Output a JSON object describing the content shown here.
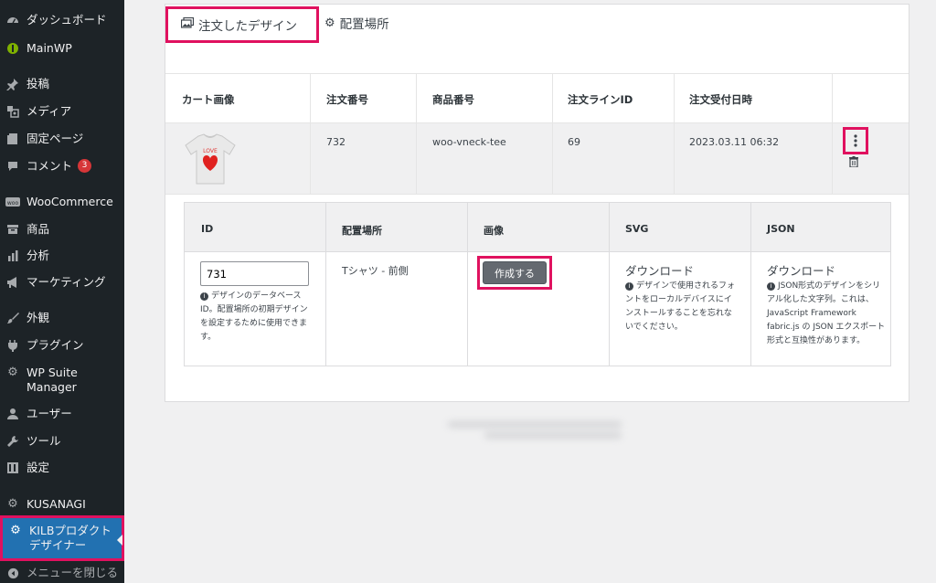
{
  "sidebar": {
    "items": [
      {
        "label": "ダッシュボード",
        "icon": "dashboard-icon"
      },
      {
        "label": "MainWP",
        "icon": "mainwp-icon"
      },
      {
        "label": "投稿",
        "icon": "pin-icon"
      },
      {
        "label": "メディア",
        "icon": "media-icon"
      },
      {
        "label": "固定ページ",
        "icon": "page-icon"
      },
      {
        "label": "コメント",
        "icon": "comment-icon",
        "badge": "3"
      },
      {
        "label": "WooCommerce",
        "icon": "woo-icon"
      },
      {
        "label": "商品",
        "icon": "archive-icon"
      },
      {
        "label": "分析",
        "icon": "chart-icon"
      },
      {
        "label": "マーケティング",
        "icon": "megaphone-icon"
      },
      {
        "label": "外観",
        "icon": "brush-icon"
      },
      {
        "label": "プラグイン",
        "icon": "plugin-icon"
      },
      {
        "label": "WP Suite Manager",
        "icon": "gear-icon"
      },
      {
        "label": "ユーザー",
        "icon": "user-icon"
      },
      {
        "label": "ツール",
        "icon": "wrench-icon"
      },
      {
        "label": "設定",
        "icon": "settings-icon"
      },
      {
        "label": "KUSANAGI",
        "icon": "gear-icon"
      },
      {
        "label": "KILBプロダクトデザイナー",
        "icon": "gear-icon"
      }
    ],
    "collapse_label": "メニューを閉じる"
  },
  "tabs": {
    "ordered": "注文したデザイン",
    "placement": "配置場所"
  },
  "order_table": {
    "headers": [
      "カート画像",
      "注文番号",
      "商品番号",
      "注文ラインID",
      "注文受付日時"
    ],
    "row": {
      "order_no": "732",
      "product_no": "woo-vneck-tee",
      "line_id": "69",
      "received": "2023.03.11 06:32",
      "image_text": "LOVE"
    }
  },
  "detail_table": {
    "headers": [
      "ID",
      "配置場所",
      "画像",
      "SVG",
      "JSON"
    ],
    "id_value": "731",
    "id_help": "デザインのデータベースID。配置場所の初期デザインを設定するために使用できます。",
    "placement": "Tシャツ - 前側",
    "create_label": "作成する",
    "svg_download": "ダウンロード",
    "svg_help": "デザインで使用されるフォントをローカルデバイスにインストールすることを忘れないでください。",
    "json_download": "ダウンロード",
    "json_help": "JSON形式のデザインをシリアル化した文字列。これは、JavaScript Framework fabric.js の JSON エクスポート形式と互換性があります。"
  },
  "colors": {
    "sidebar_bg": "#1d2327",
    "active_bg": "#2271b1",
    "highlight": "#e0115f",
    "badge": "#d63638"
  }
}
